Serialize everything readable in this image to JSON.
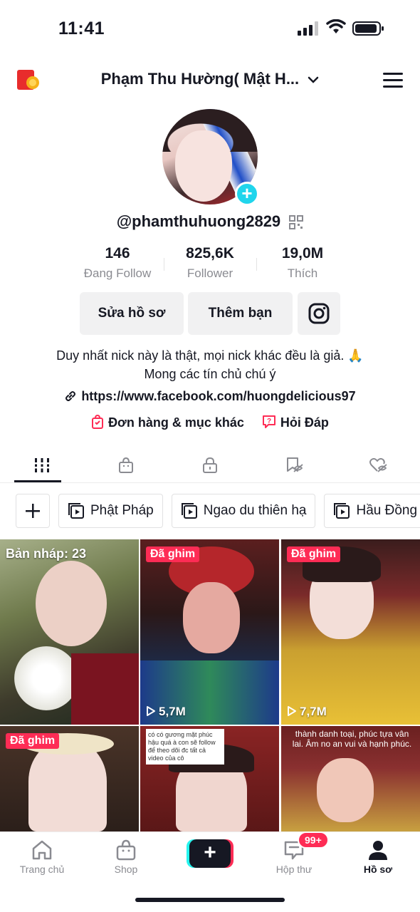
{
  "status_bar": {
    "time": "11:41"
  },
  "header": {
    "profile_name": "Phạm Thu Hường( Mật H..."
  },
  "profile": {
    "username": "@phamthuhuong2829",
    "stats": [
      {
        "value": "146",
        "label": "Đang Follow"
      },
      {
        "value": "825,6K",
        "label": "Follower"
      },
      {
        "value": "19,0M",
        "label": "Thích"
      }
    ],
    "edit_button": "Sửa hồ sơ",
    "add_friend_button": "Thêm bạn",
    "bio_line1": "Duy nhất nick này là thật, mọi nick khác đều là giả. 🙏",
    "bio_line2": "Mong các tín chủ chú ý",
    "link": "https://www.facebook.com/huongdelicious97",
    "orders_label": "Đơn hàng & mục khác",
    "qa_label": "Hỏi Đáp"
  },
  "playlists": [
    {
      "label": "Phật Pháp"
    },
    {
      "label": "Ngao du thiên hạ"
    },
    {
      "label": "Hầu Đồng -"
    }
  ],
  "videos": [
    {
      "badge": "Bản nháp: 23",
      "views": ""
    },
    {
      "badge": "Đã ghim",
      "views": "5,7M"
    },
    {
      "badge": "Đã ghim",
      "views": "7,7M"
    },
    {
      "badge": "Đã ghim",
      "views": ""
    },
    {
      "caption": "có có gương mặt phúc hậu quá à con sẽ follow để theo dõi đc tất cả video của cô"
    },
    {
      "caption": "thành danh toại, phúc tựa vân lai. Âm no an vui và hạnh phúc."
    }
  ],
  "bottom_nav": {
    "home": "Trang chủ",
    "shop": "Shop",
    "inbox": "Hộp thư",
    "inbox_badge": "99+",
    "me": "Hồ sơ"
  },
  "colors": {
    "accent": "#fe2c55",
    "cyan": "#20d5ec",
    "text": "#161823",
    "muted": "#8a8b91"
  }
}
